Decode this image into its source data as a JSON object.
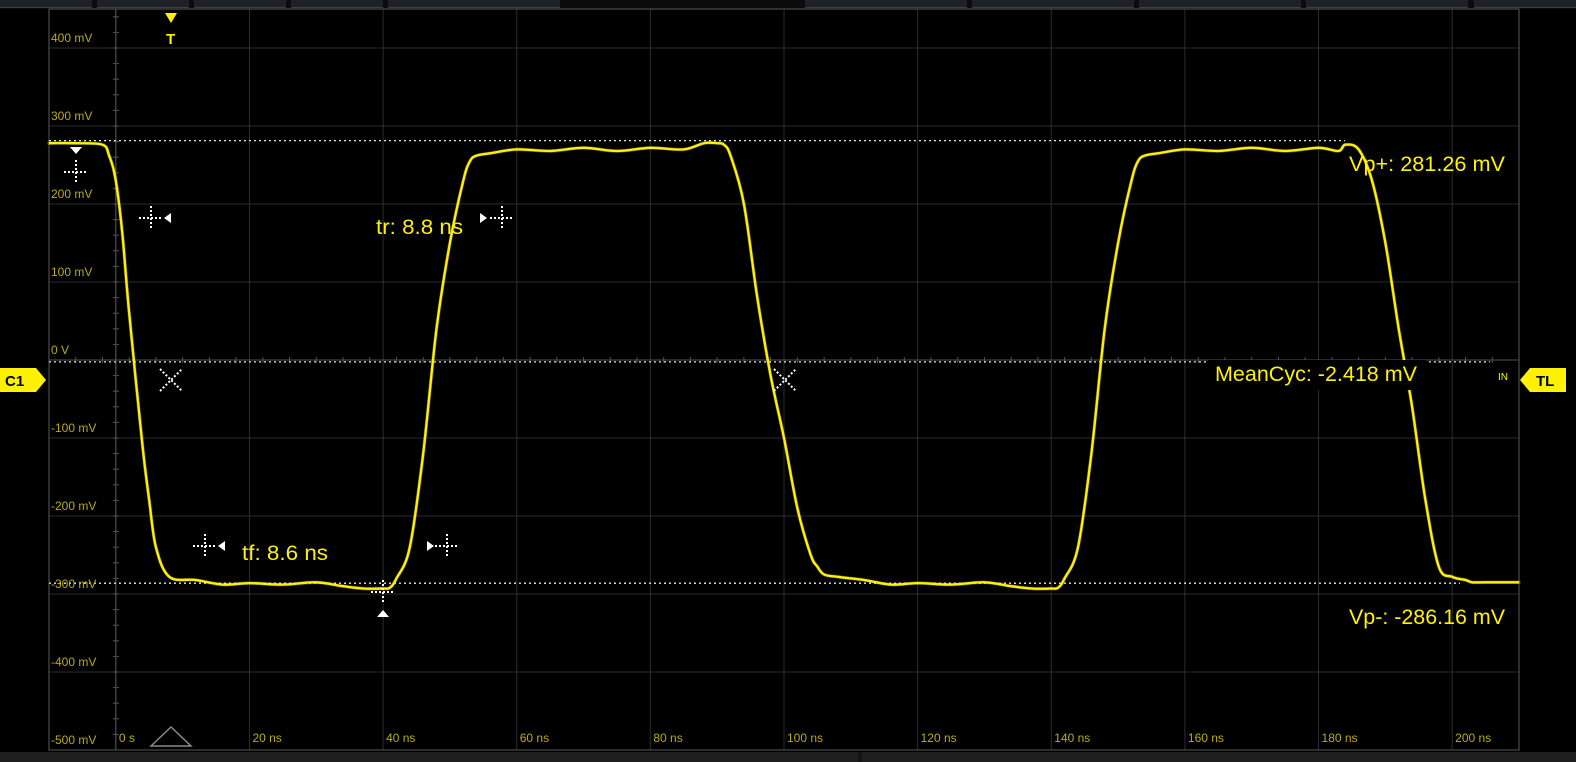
{
  "chart_data": {
    "type": "line",
    "title": "",
    "xlabel": "",
    "ylabel": "",
    "x_unit": "ns",
    "y_unit": "mV",
    "xlim": [
      -10,
      210
    ],
    "ylim": [
      -500,
      450
    ],
    "grid": true,
    "x_ticks": [
      {
        "value": 0,
        "label": "0 s"
      },
      {
        "value": 20,
        "label": "20 ns"
      },
      {
        "value": 40,
        "label": "40 ns"
      },
      {
        "value": 60,
        "label": "60 ns"
      },
      {
        "value": 80,
        "label": "80 ns"
      },
      {
        "value": 100,
        "label": "100 ns"
      },
      {
        "value": 120,
        "label": "120 ns"
      },
      {
        "value": 140,
        "label": "140 ns"
      },
      {
        "value": 160,
        "label": "160 ns"
      },
      {
        "value": 180,
        "label": "180 ns"
      },
      {
        "value": 200,
        "label": "200 ns"
      }
    ],
    "y_ticks": [
      {
        "value": 400,
        "label": "400 mV"
      },
      {
        "value": 300,
        "label": "300 mV"
      },
      {
        "value": 200,
        "label": "200 mV"
      },
      {
        "value": 100,
        "label": "100 mV"
      },
      {
        "value": 0,
        "label": "0 V"
      },
      {
        "value": -100,
        "label": "-100 mV"
      },
      {
        "value": -200,
        "label": "-200 mV"
      },
      {
        "value": -300,
        "label": "-300 mV"
      },
      {
        "value": -400,
        "label": "-400 mV"
      },
      {
        "value": -500,
        "label": "-500 mV"
      }
    ],
    "series": [
      {
        "channel": "C1",
        "x": [
          -10,
          -6,
          -2,
          -1,
          0,
          1,
          2,
          4,
          5,
          6,
          8,
          12,
          16,
          20,
          25,
          30,
          34,
          37,
          40,
          41,
          42,
          44,
          46,
          48,
          50,
          52,
          53,
          54,
          56,
          60,
          65,
          70,
          75,
          80,
          85,
          88,
          90,
          91,
          92,
          94,
          96,
          98,
          100,
          102,
          104,
          105,
          106,
          108,
          112,
          116,
          120,
          125,
          130,
          134,
          137,
          140,
          141,
          142,
          144,
          146,
          148,
          150,
          152,
          153,
          154,
          156,
          160,
          165,
          170,
          175,
          180,
          183,
          184,
          186,
          188,
          190,
          192,
          194,
          196,
          198,
          200,
          202,
          203,
          205,
          210
        ],
        "y": [
          278,
          278,
          276,
          262,
          230,
          160,
          60,
          -110,
          -180,
          -240,
          -278,
          -282,
          -288,
          -286,
          -288,
          -285,
          -290,
          -293,
          -293,
          -292,
          -280,
          -240,
          -120,
          40,
          150,
          230,
          255,
          262,
          265,
          270,
          268,
          272,
          268,
          272,
          270,
          278,
          278,
          276,
          262,
          200,
          80,
          -20,
          -100,
          -190,
          -250,
          -265,
          -275,
          -278,
          -282,
          -288,
          -286,
          -288,
          -285,
          -290,
          -293,
          -293,
          -292,
          -280,
          -240,
          -120,
          40,
          150,
          230,
          255,
          262,
          265,
          270,
          268,
          272,
          268,
          272,
          268,
          276,
          270,
          230,
          150,
          40,
          -60,
          -180,
          -265,
          -278,
          -282,
          -285,
          -285,
          -285
        ]
      }
    ],
    "reference_lines": {
      "top_y": 281.26,
      "base_y": -286.16,
      "mean_y": -2.418
    },
    "measurements": {
      "rise": "tr: 8.8 ns",
      "fall": "tf: 8.6 ns",
      "vp_plus": "Vp+: 281.26 mV",
      "vp_minus": "Vp-: -286.16 mV",
      "mean_cyc": "MeanCyc: -2.418 mV"
    },
    "markers": {
      "channel": "C1",
      "trigger": "T",
      "trigger_level": "TL",
      "input": "IN"
    },
    "colors": {
      "trace": "#ffef0f",
      "marker": "#fff200",
      "grid": "#2d2d2d",
      "axis": "#555555",
      "tick_label": "#b8aa1c",
      "reference": "#e6e6e6",
      "measure_cursor": "#ffffff"
    }
  }
}
